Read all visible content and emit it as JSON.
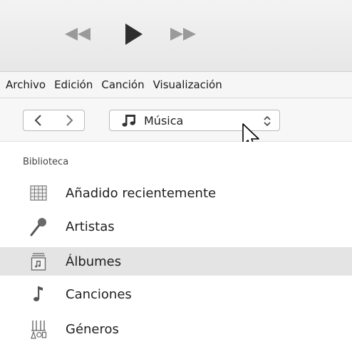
{
  "toolbar": {
    "rewind_icon": "rewind-icon",
    "play_icon": "play-icon",
    "forward_icon": "fast-forward-icon"
  },
  "menubar": {
    "items": [
      "Archivo",
      "Edición",
      "Canción",
      "Visualización"
    ]
  },
  "navigation": {
    "back_icon": "chevron-left-icon",
    "forward_icon": "chevron-right-icon",
    "selector": {
      "icon": "music-note-icon",
      "label": "Música",
      "updown_icon": "up-down-chevron-icon"
    }
  },
  "sidebar": {
    "section_title": "Biblioteca",
    "items": [
      {
        "label": "Añadido recientemente",
        "icon": "grid-icon"
      },
      {
        "label": "Artistas",
        "icon": "microphone-icon"
      },
      {
        "label": "Álbumes",
        "icon": "album-icon",
        "selected": true
      },
      {
        "label": "Canciones",
        "icon": "music-note-icon"
      },
      {
        "label": "Géneros",
        "icon": "genres-icon"
      }
    ]
  },
  "colors": {
    "selected_row": "#e4e4e4",
    "toolbar_bg": "#eeeeee",
    "icon_gray": "#666666"
  }
}
